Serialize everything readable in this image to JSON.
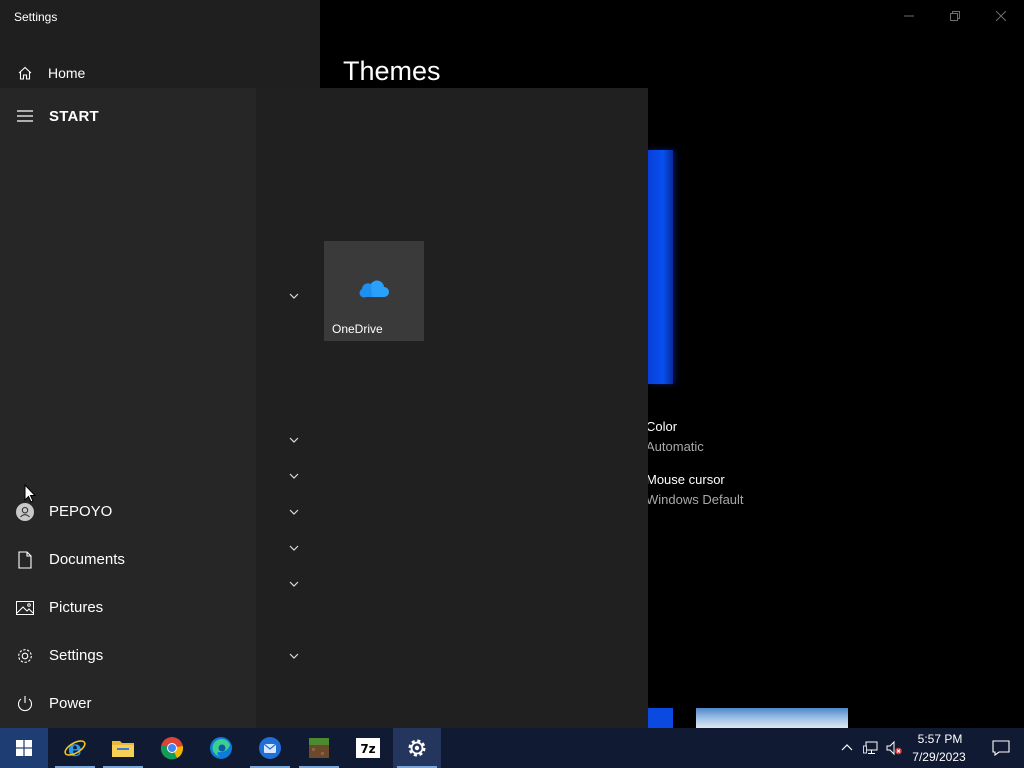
{
  "window": {
    "title": "Settings",
    "home_label": "Home",
    "page_heading": "Themes",
    "minimize_icon": "minimize-icon",
    "maximize_icon": "restore-icon",
    "close_icon": "close-icon"
  },
  "themes": {
    "color_label": "Color",
    "color_value": "Automatic",
    "cursor_label": "Mouse cursor",
    "cursor_value": "Windows Default"
  },
  "start_menu": {
    "header_label": "START",
    "user_label": "PEPOYO",
    "documents_label": "Documents",
    "pictures_label": "Pictures",
    "settings_label": "Settings",
    "power_label": "Power",
    "tile_onedrive_label": "OneDrive"
  },
  "taskbar": {
    "apps": [
      {
        "name": "internet-explorer-icon"
      },
      {
        "name": "file-explorer-icon"
      },
      {
        "name": "chrome-icon"
      },
      {
        "name": "edge-icon"
      },
      {
        "name": "thunderbird-icon"
      },
      {
        "name": "minecraft-icon"
      },
      {
        "name": "7zip-icon",
        "text": "7z"
      },
      {
        "name": "settings-gear-icon"
      }
    ],
    "clock_time": "5:57 PM",
    "clock_date": "7/29/2023"
  },
  "colors": {
    "accent": "#0a4ae0",
    "taskbar": "#101a33",
    "start_menu": "#232323"
  }
}
